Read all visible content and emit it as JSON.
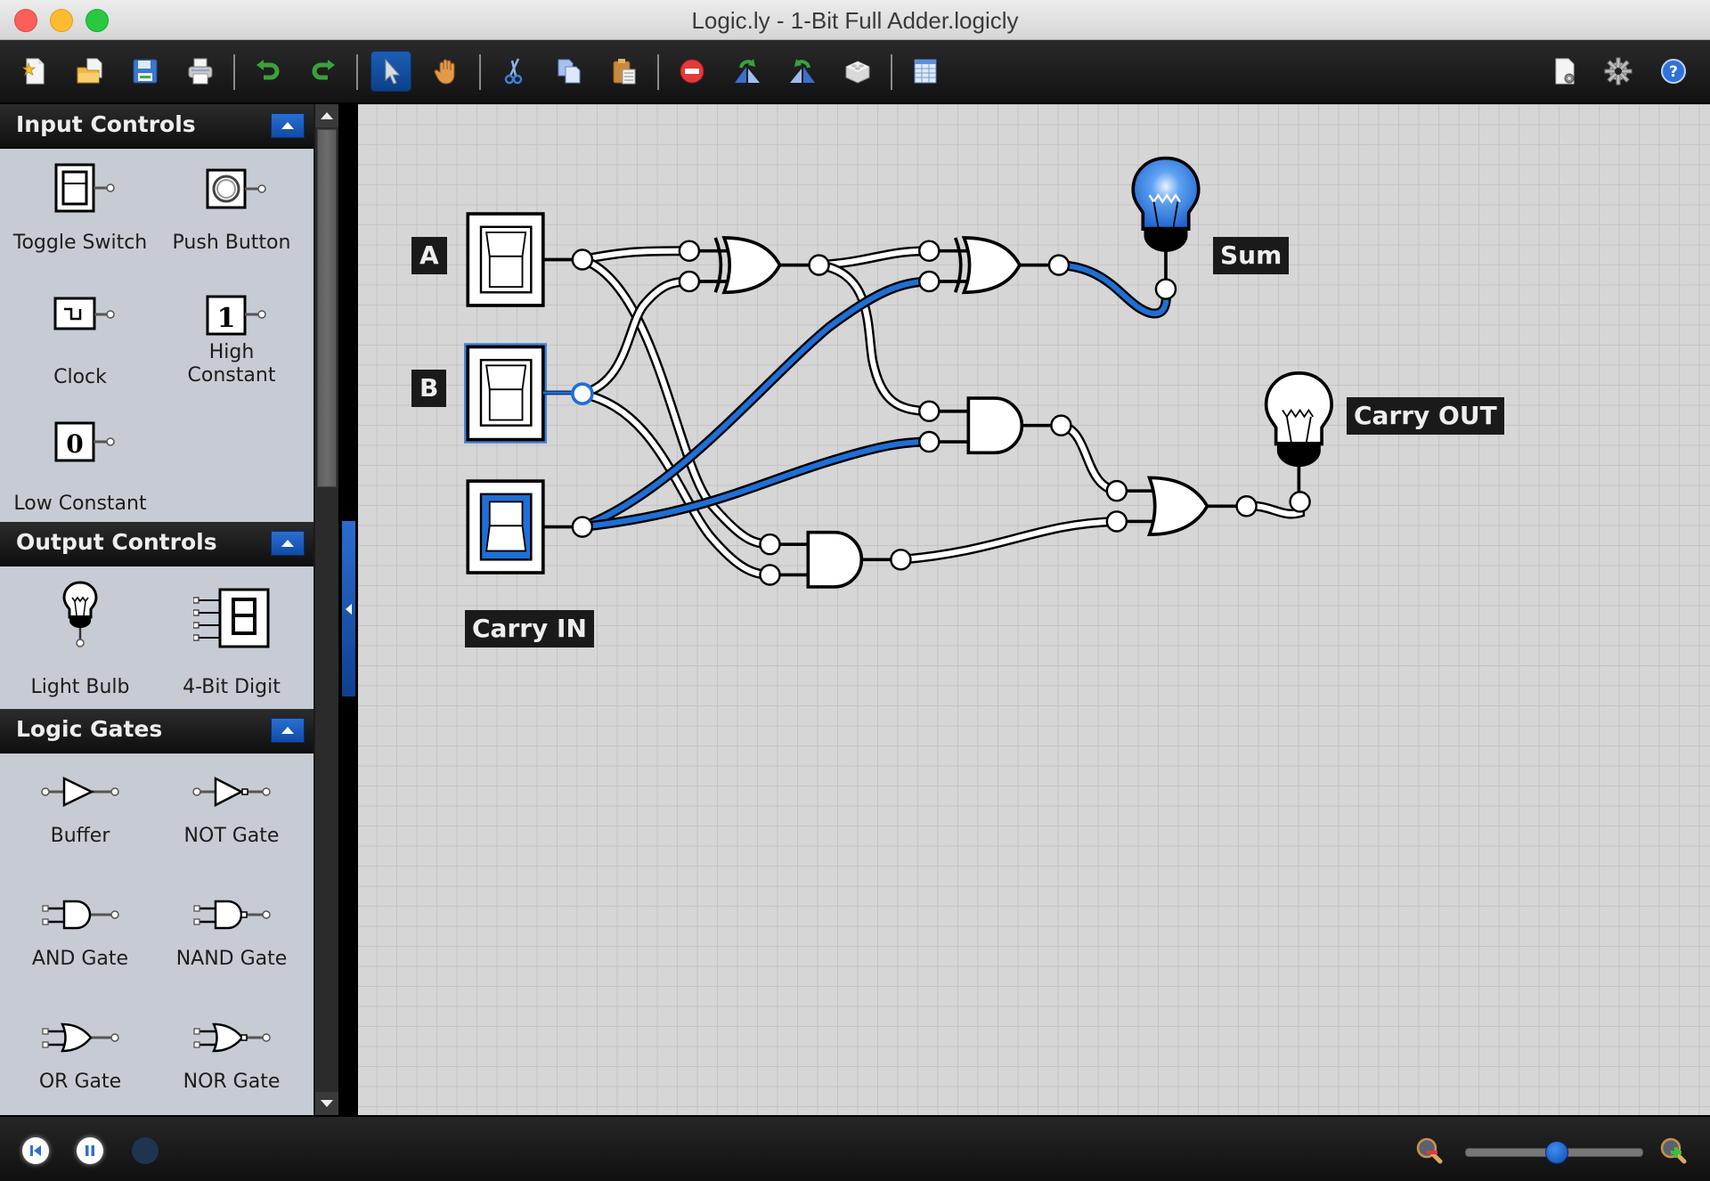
{
  "window": {
    "title": "Logic.ly - 1-Bit Full Adder.logicly"
  },
  "toolbar": {
    "buttons": [
      {
        "name": "new-file",
        "icon": "new-file-icon",
        "tooltip": "New"
      },
      {
        "name": "open-file",
        "icon": "open-folder-icon",
        "tooltip": "Open"
      },
      {
        "name": "save",
        "icon": "floppy-disk-icon",
        "tooltip": "Save"
      },
      {
        "name": "print",
        "icon": "printer-icon",
        "tooltip": "Print"
      },
      {
        "name": "undo",
        "icon": "undo-icon",
        "tooltip": "Undo"
      },
      {
        "name": "redo",
        "icon": "redo-icon",
        "tooltip": "Redo"
      },
      {
        "name": "select-tool",
        "icon": "arrow-pointer-icon",
        "tooltip": "Select",
        "active": true
      },
      {
        "name": "pan-tool",
        "icon": "hand-icon",
        "tooltip": "Pan"
      },
      {
        "name": "cut",
        "icon": "scissors-icon",
        "tooltip": "Cut"
      },
      {
        "name": "copy",
        "icon": "copy-icon",
        "tooltip": "Copy"
      },
      {
        "name": "paste",
        "icon": "clipboard-icon",
        "tooltip": "Paste"
      },
      {
        "name": "delete",
        "icon": "delete-icon",
        "tooltip": "Delete"
      },
      {
        "name": "flip-horizontal",
        "icon": "flip-horizontal-icon",
        "tooltip": "Flip Horizontal"
      },
      {
        "name": "flip-vertical",
        "icon": "flip-vertical-icon",
        "tooltip": "Flip Vertical"
      },
      {
        "name": "integrated-circuit",
        "icon": "brick-icon",
        "tooltip": "Create Integrated Circuit"
      },
      {
        "name": "truth-table",
        "icon": "table-icon",
        "tooltip": "Truth Table"
      },
      {
        "name": "page-setup",
        "icon": "document-gear-icon",
        "tooltip": "Document Settings"
      },
      {
        "name": "preferences",
        "icon": "gear-icon",
        "tooltip": "Preferences"
      },
      {
        "name": "help",
        "icon": "help-icon",
        "tooltip": "Help"
      }
    ]
  },
  "sidebar": {
    "sections": [
      {
        "title": "Input Controls",
        "items": [
          {
            "label": "Toggle Switch",
            "icon": "toggle-switch-icon"
          },
          {
            "label": "Push Button",
            "icon": "push-button-icon"
          },
          {
            "label": "Clock",
            "icon": "clock-icon"
          },
          {
            "label": "High\nConstant",
            "icon": "high-constant-icon",
            "symbol": "1"
          },
          {
            "label": "Low Constant",
            "icon": "low-constant-icon",
            "symbol": "0"
          }
        ]
      },
      {
        "title": "Output Controls",
        "items": [
          {
            "label": "Light Bulb",
            "icon": "light-bulb-icon"
          },
          {
            "label": "4-Bit Digit",
            "icon": "seven-segment-icon"
          }
        ]
      },
      {
        "title": "Logic Gates",
        "items": [
          {
            "label": "Buffer",
            "icon": "buffer-gate-icon"
          },
          {
            "label": "NOT Gate",
            "icon": "not-gate-icon"
          },
          {
            "label": "AND Gate",
            "icon": "and-gate-icon"
          },
          {
            "label": "NAND Gate",
            "icon": "nand-gate-icon"
          },
          {
            "label": "OR Gate",
            "icon": "or-gate-icon"
          },
          {
            "label": "NOR Gate",
            "icon": "nor-gate-icon"
          }
        ]
      }
    ]
  },
  "canvas": {
    "labels": {
      "a": "A",
      "b": "B",
      "carry_in": "Carry IN",
      "sum": "Sum",
      "carry_out": "Carry OUT"
    },
    "inputs": [
      {
        "id": "A",
        "type": "toggle-switch",
        "state": "off"
      },
      {
        "id": "B",
        "type": "toggle-switch",
        "state": "off",
        "selected": true
      },
      {
        "id": "Cin",
        "type": "toggle-switch",
        "state": "on"
      }
    ],
    "gates": [
      {
        "id": "xor1",
        "type": "XOR",
        "inputs": [
          "A",
          "B"
        ],
        "output": "off"
      },
      {
        "id": "xor2",
        "type": "XOR",
        "inputs": [
          "xor1",
          "Cin"
        ],
        "output": "on"
      },
      {
        "id": "and1",
        "type": "AND",
        "inputs": [
          "xor1",
          "Cin"
        ],
        "output": "off"
      },
      {
        "id": "and2",
        "type": "AND",
        "inputs": [
          "A",
          "B"
        ],
        "output": "off"
      },
      {
        "id": "or1",
        "type": "OR",
        "inputs": [
          "and1",
          "and2"
        ],
        "output": "off"
      }
    ],
    "outputs": [
      {
        "id": "Sum",
        "type": "light-bulb",
        "state": "on"
      },
      {
        "id": "CarryOut",
        "type": "light-bulb",
        "state": "off"
      }
    ],
    "colors": {
      "wire_on": "#1f6fd6",
      "wire_off": "#ffffff",
      "bulb_on": "#2a7fe8",
      "background": "#d6d6d6"
    }
  },
  "bottombar": {
    "reset_label": "Reset",
    "pause_label": "Pause",
    "step_label": "Step",
    "zoom_level": 0.52
  }
}
